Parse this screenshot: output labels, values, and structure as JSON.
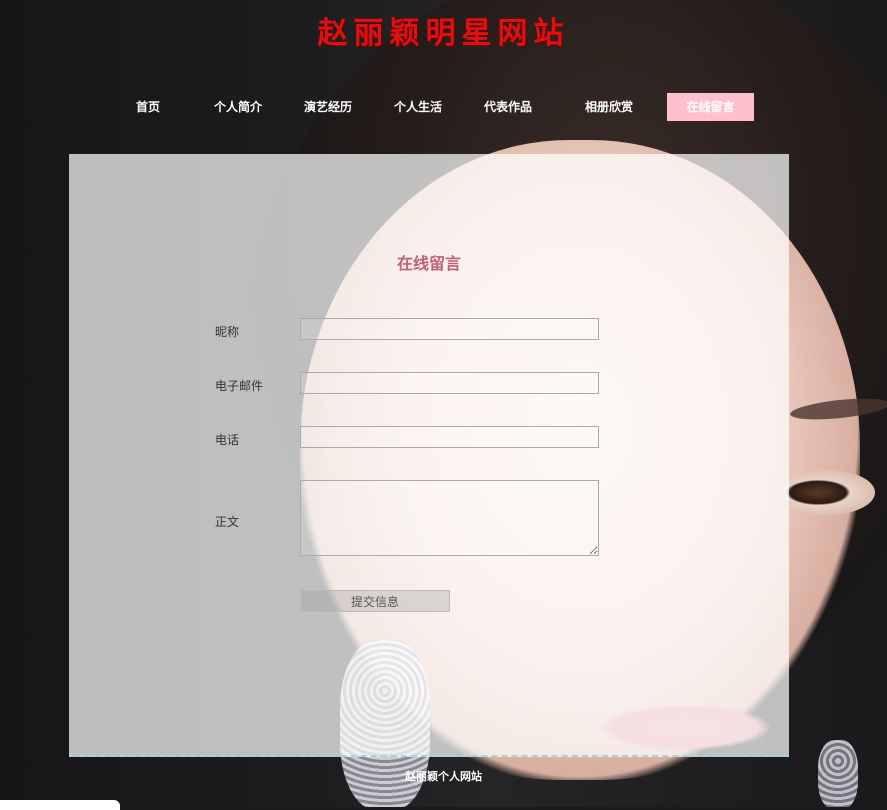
{
  "site": {
    "title": "赵丽颖明星网站"
  },
  "nav": {
    "items": [
      {
        "label": "首页"
      },
      {
        "label": "个人简介"
      },
      {
        "label": "演艺经历"
      },
      {
        "label": "个人生活"
      },
      {
        "label": "代表作品"
      },
      {
        "label": "相册欣赏"
      },
      {
        "label": "在线留言",
        "active": true
      }
    ],
    "active_color": "#ffc0cb"
  },
  "form": {
    "title": "在线留言",
    "fields": {
      "nickname": {
        "label": "昵称",
        "value": ""
      },
      "email": {
        "label": "电子邮件",
        "value": ""
      },
      "phone": {
        "label": "电话",
        "value": ""
      },
      "body": {
        "label": "正文",
        "value": ""
      }
    },
    "submit_label": "提交信息"
  },
  "footer": {
    "text": "赵丽颖个人网站"
  },
  "colors": {
    "title_red": "#e01010",
    "form_title": "#c06070",
    "background": "#1b1a1c"
  }
}
